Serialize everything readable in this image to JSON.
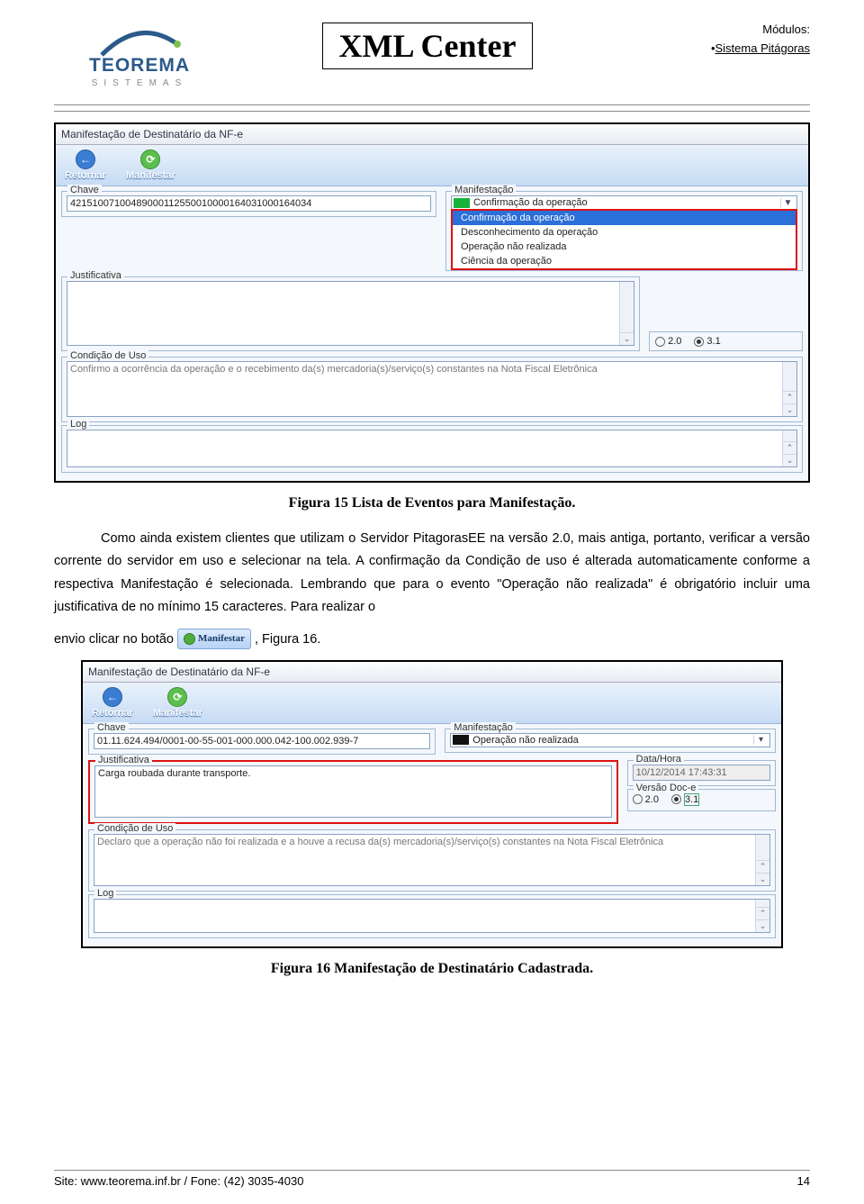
{
  "header": {
    "logo_main": "TEOREMA",
    "logo_sub": "SISTEMAS",
    "title": "XML Center",
    "modules_label": "Módulos:",
    "modules_item": "Sistema Pitágoras"
  },
  "screenshot1": {
    "window_title": "Manifestação de Destinatário da NF-e",
    "toolbar": {
      "retornar": "Retornar",
      "manifestar": "Manifestar"
    },
    "chave_label": "Chave",
    "chave_value": "42151007100489000112550010000164031000164034",
    "manifestacao_label": "Manifestação",
    "manifestacao_selected": "Confirmação da operação",
    "options": [
      {
        "flag": "green",
        "text": "Confirmação da operação"
      },
      {
        "flag": "red",
        "text": "Desconhecimento da operação"
      },
      {
        "flag": "black",
        "text": "Operação não realizada"
      },
      {
        "flag": "yellow",
        "text": "Ciência da operação"
      }
    ],
    "justificativa_label": "Justificativa",
    "version20": "2.0",
    "version31": "3.1",
    "condicao_label": "Condição de Uso",
    "condicao_text": "Confirmo a ocorrência da operação e o recebimento da(s) mercadoria(s)/serviço(s) constantes na Nota Fiscal Eletrônica",
    "log_label": "Log"
  },
  "caption1": "Figura 15 Lista de Eventos para Manifestação.",
  "paragraph1": "Como ainda existem clientes que utilizam o Servidor PitagorasEE na versão 2.0, mais antiga, portanto, verificar a versão corrente do servidor em uso e selecionar na tela. A confirmação da Condição de uso é alterada automaticamente conforme a respectiva Manifestação é selecionada. Lembrando que para o evento \"Operação não realizada\" é obrigatório incluir uma justificativa de no mínimo 15 caracteres. Para realizar o",
  "paragraph2_prefix": "envio clicar no botão ",
  "paragraph2_button": "Manifestar",
  "paragraph2_suffix": " , Figura 16.",
  "screenshot2": {
    "window_title": "Manifestação de Destinatário da NF-e",
    "toolbar": {
      "retornar": "Retornar",
      "manifestar": "Manifestar"
    },
    "chave_label": "Chave",
    "chave_value": "01.11.624.494/0001-00-55-001-000.000.042-100.002.939-7",
    "manifestacao_label": "Manifestação",
    "manifestacao_selected": "Operação não realizada",
    "justificativa_label": "Justificativa",
    "justificativa_value": "Carga roubada durante transporte.",
    "datahora_label": "Data/Hora",
    "datahora_value": "10/12/2014 17:43:31",
    "versao_label": "Versão Doc-e",
    "version20": "2.0",
    "version31": "3.1",
    "condicao_label": "Condição de Uso",
    "condicao_text": "Declaro que a operação não foi realizada e a houve a recusa da(s) mercadoria(s)/serviço(s) constantes na Nota Fiscal Eletrônica",
    "log_label": "Log"
  },
  "caption2": "Figura 16 Manifestação de Destinatário Cadastrada.",
  "footer": {
    "site": "Site: www.teorema.inf.br / Fone: (42) 3035-4030",
    "page": "14"
  }
}
